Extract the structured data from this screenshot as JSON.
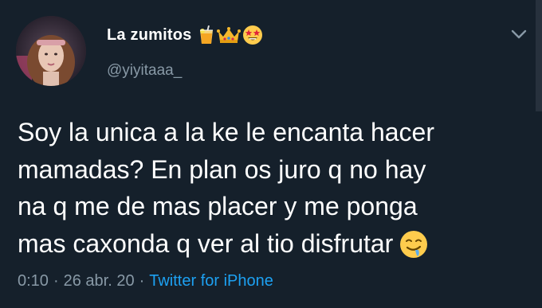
{
  "author": {
    "display_name": "La zumitos",
    "handle": "@yiyitaaa_",
    "name_emojis": [
      "tropical-drink-emoji",
      "crown-emoji",
      "star-struck-emoji"
    ]
  },
  "tweet": {
    "lines": [
      "Soy la unica a la ke le encanta hacer",
      "mamadas? En plan os juro q no hay",
      "na q me de mas placer y me ponga",
      "mas caxonda q ver al tio disfrutar"
    ],
    "trailing_emoji": "drooling-face-emoji"
  },
  "meta": {
    "time": "0:10",
    "separator": "·",
    "date": "26 abr. 20",
    "source": "Twitter for iPhone"
  },
  "icons": {
    "menu": "chevron-down-icon"
  },
  "colors": {
    "background": "#15202b",
    "text": "#ffffff",
    "secondary_text": "#8899a6",
    "link": "#1da1f2"
  }
}
